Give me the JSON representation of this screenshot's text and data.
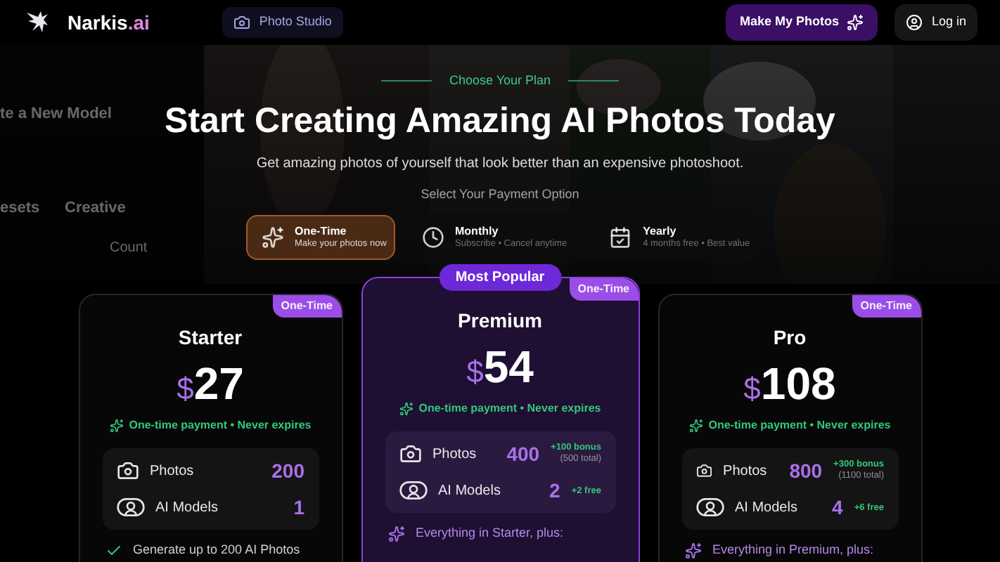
{
  "nav": {
    "brand": "Narkis",
    "brand_suffix": ".ai",
    "studio_link": "Photo Studio",
    "cta": "Make My Photos",
    "login": "Log in"
  },
  "background_ui": [
    "te a New Model",
    "esets",
    "Creative",
    "Count"
  ],
  "hero": {
    "eyebrow": "Choose Your Plan",
    "title": "Start Creating Amazing AI Photos Today",
    "subtitle": "Get amazing photos of yourself that look better than an expensive photoshoot.",
    "payment_label": "Select Your Payment Option"
  },
  "payment_options": [
    {
      "kind": "sparkle",
      "title": "One-Time",
      "subtitle": "Make your photos now",
      "selected": true
    },
    {
      "kind": "clock",
      "title": "Monthly",
      "subtitle": "Subscribe • Cancel anytime",
      "selected": false
    },
    {
      "kind": "calendar",
      "title": "Yearly",
      "subtitle": "4 months free • Best value",
      "selected": false
    }
  ],
  "plans": [
    {
      "name": "Starter",
      "featured": false,
      "badge": "One-Time",
      "currency": "$",
      "price": "27",
      "note": "One-time payment • Never expires",
      "photos": {
        "label": "Photos",
        "value": "200"
      },
      "models": {
        "label": "AI Models",
        "value": "1"
      },
      "feature": {
        "kind": "check",
        "text": "Generate up to 200 AI Photos"
      }
    },
    {
      "name": "Premium",
      "featured": true,
      "popular": "Most Popular",
      "badge": "One-Time",
      "currency": "$",
      "price": "54",
      "note": "One-time payment • Never expires",
      "photos": {
        "label": "Photos",
        "value": "400",
        "bonus": "+100 bonus",
        "total": "(500 total)"
      },
      "models": {
        "label": "AI Models",
        "value": "2",
        "bonus": "+2 free"
      },
      "feature": {
        "kind": "plus",
        "text": "Everything in Starter, plus:"
      }
    },
    {
      "name": "Pro",
      "featured": false,
      "badge": "One-Time",
      "currency": "$",
      "price": "108",
      "note": "One-time payment • Never expires",
      "photos": {
        "label": "Photos",
        "value": "800",
        "bonus": "+300 bonus",
        "total": "(1100 total)"
      },
      "models": {
        "label": "AI Models",
        "value": "4",
        "bonus": "+6 free"
      },
      "feature": {
        "kind": "plus",
        "text": "Everything in Premium, plus:"
      }
    }
  ]
}
